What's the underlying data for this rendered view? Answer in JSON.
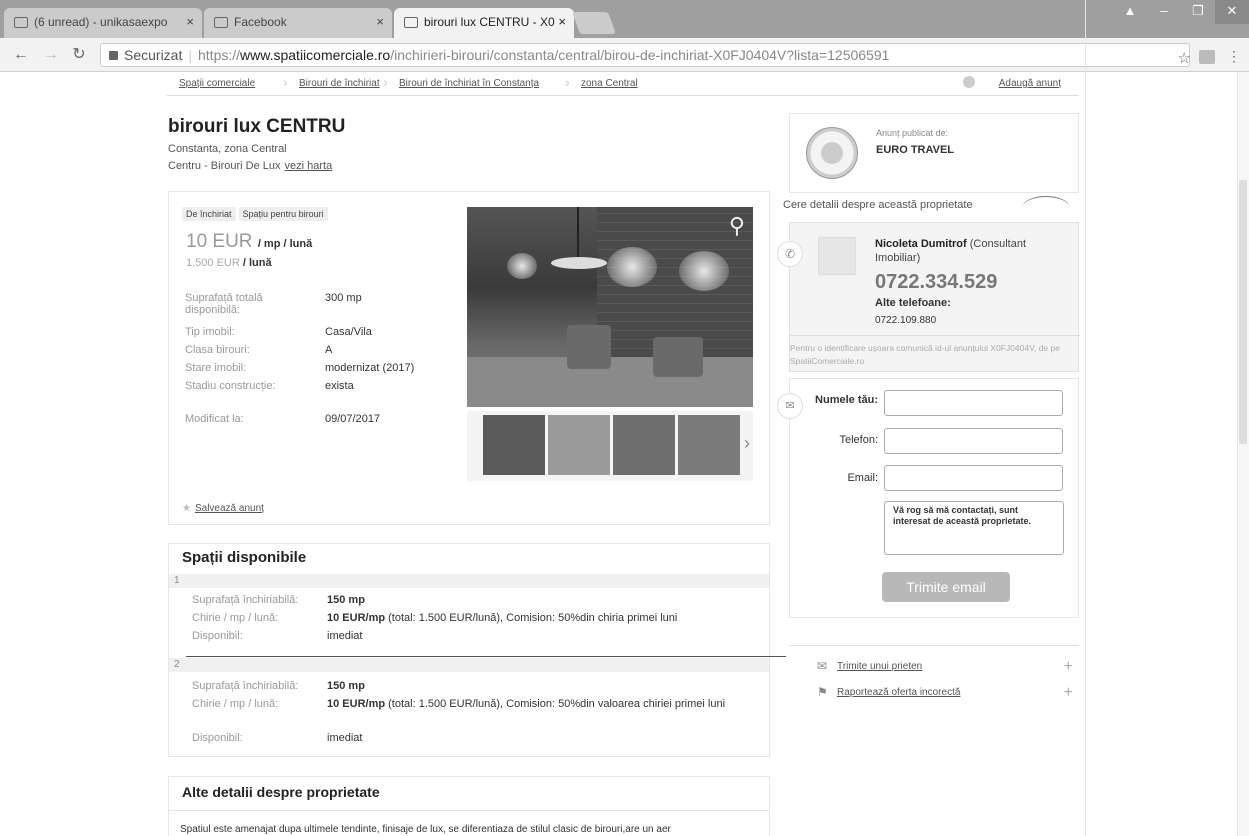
{
  "browser": {
    "tabs": [
      {
        "label": "(6 unread) - unikasaexpo"
      },
      {
        "label": "Facebook"
      },
      {
        "label": "birouri lux CENTRU - X0"
      }
    ],
    "security_label": "Securizat",
    "url_scheme": "https://",
    "url_host": "www.spatiicomerciale.ro",
    "url_rest": "/inchirieri-birouri/constanta/central/birou-de-inchiriat-X0FJ0404V?lista=12506591",
    "close_glyph": "×"
  },
  "breadcrumb": [
    "Spații comerciale",
    "Birouri de închiriat",
    "Birouri de închiriat în Constanța",
    "zona Central"
  ],
  "add_listing": "Adaugă anunț",
  "listing": {
    "title": "birouri lux CENTRU",
    "location_line1": "Constanta, zona Central",
    "location_line2": "Centru - Birouri De Lux",
    "map_link": "vezi harta",
    "tags": [
      "De închiriat",
      "Spațiu pentru birouri"
    ],
    "price": "10 EUR",
    "price_unit": "/ mp / lună",
    "price_total": "1.500 EUR",
    "price_total_unit": "/ lună",
    "properties": [
      {
        "key": "Suprafață totală disponibilă:",
        "value": "300 mp"
      },
      {
        "key": "Tip imobil:",
        "value": "Casa/Vila"
      },
      {
        "key": "Clasa birouri:",
        "value": "A"
      },
      {
        "key": "Stare imobil:",
        "value": "modernizat (2017)"
      },
      {
        "key": "Stadiu construcție:",
        "value": "exista"
      },
      {
        "key": "Modificat la:",
        "value": "09/07/2017"
      }
    ],
    "save_label": "Salvează anunț"
  },
  "spaces": {
    "title": "Spații disponibile",
    "items": [
      {
        "num": "1",
        "area_key": "Suprafață închiriabilă:",
        "area": "150 mp",
        "rent_key": "Chirie / mp / lună:",
        "rent_bold": "10 EUR/mp",
        "rent_rest": " (total: 1.500 EUR/lună), Comision: 50%din chiria primei luni",
        "avail_key": "Disponibil:",
        "avail": "imediat"
      },
      {
        "num": "2",
        "area_key": "Suprafață închiriabilă:",
        "area": "150 mp",
        "rent_key": "Chirie / mp / lună:",
        "rent_bold": "10 EUR/mp",
        "rent_rest": " (total: 1.500 EUR/lună), Comision: 50%din valoarea chiriei primei luni",
        "avail_key": "Disponibil:",
        "avail": "imediat"
      }
    ]
  },
  "details": {
    "title": "Alte detalii despre proprietate",
    "text": "Spatiul este amenajat dupa ultimele tendinte, finisaje de lux, se diferentiaza de stilul clasic de birouri,are un aer"
  },
  "publisher": {
    "label": "Anunț publicat de:",
    "name": "EURO TRAVEL"
  },
  "contact": {
    "request_title": "Cere detalii despre această proprietate",
    "agent_name": "Nicoleta Dumitrof",
    "agent_role": " (Consultant Imobiliar)",
    "phone": "0722.334.529",
    "alt_label": "Alte telefoane:",
    "alt_phone": "0722.109.880",
    "note": "Pentru o identificare ușoara comunică id-ul anunțului X0FJ0404V, de pe SpatiiComerciale.ro",
    "name_label": "Numele tău:",
    "phone_label": "Telefon:",
    "email_label": "Email:",
    "message": "Vă rog să mă contactați, sunt interesat de această proprietate.",
    "send_label": "Trimite email"
  },
  "actions": [
    {
      "label": "Trimite unui prieten"
    },
    {
      "label": "Raportează oferta incorectă"
    }
  ]
}
